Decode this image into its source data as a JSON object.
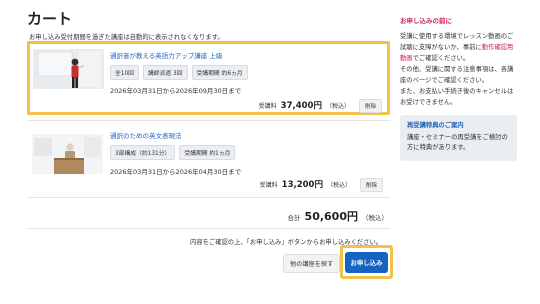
{
  "page_title": "カート",
  "notice": "お申し込み受付期間を過ぎた講座は自動的に表示されなくなります。",
  "items": [
    {
      "course_name": "通訳者が教える英語力アップ講座 上級",
      "tags": [
        "全10回",
        "講師派遣 3回",
        "受講期間 約6ヵ月"
      ],
      "period": "2026年03月31日から2026年09月30日まで",
      "price_label": "受講料",
      "price_value": "37,400円",
      "price_tax": "（税込）",
      "delete_label": "削除"
    },
    {
      "course_name": "通訳のための英文表現法",
      "tags": [
        "3部構成（約131分）",
        "受講期間 約1ヵ月"
      ],
      "period": "2026年03月31日から2026年04月30日まで",
      "price_label": "受講料",
      "price_value": "13,200円",
      "price_tax": "（税込）",
      "delete_label": "削除"
    }
  ],
  "total": {
    "label": "合計",
    "value": "50,600円",
    "tax": "（税込）"
  },
  "confirm_text": "内容をご確認の上、「お申し込み」ボタンからお申し込みください。",
  "browse_button": "他の講座を探す",
  "apply_button": "お申し込み",
  "sidebar": {
    "notice_head": "お申し込みの前に",
    "notice_text_1": "受講に使用する環境でレッスン動画のご試聴に支障がないか、事前に",
    "notice_link": "動作確認用動画",
    "notice_text_2": "でご確認ください。",
    "notice_text_3": "その他、受講に関する注意事項は、各講座のページでご確認ください。",
    "notice_text_4": "また、お支払い手続き後のキャンセルはお受けできません。",
    "re_head": "再受講特典のご案内",
    "re_text": "講座・セミナーの再受講をご検討の方に特典があります。"
  },
  "colors": {
    "accent_pink": "#d01a5a",
    "link_blue": "#1f62b8",
    "highlight_yellow": "#f4c24a",
    "apply_blue": "#1565c0"
  }
}
